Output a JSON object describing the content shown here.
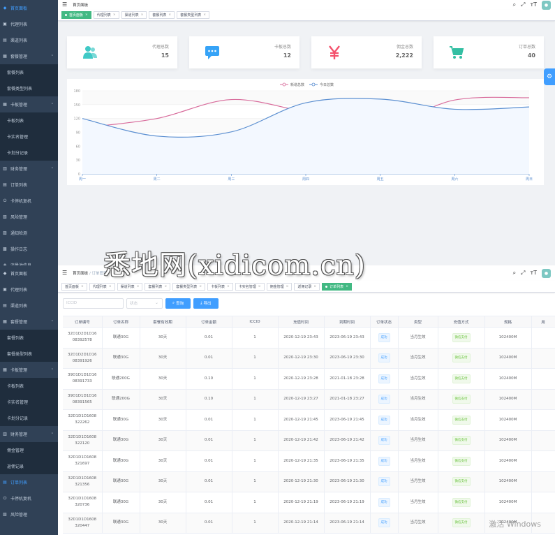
{
  "watermark": "悉地网(xidicom.cn)",
  "os_notice": "激活 Windows",
  "screen1": {
    "sidebar": [
      {
        "label": "首页面板",
        "icon": "dashboard-icon",
        "kind": "top",
        "active": true
      },
      {
        "label": "代理列表",
        "icon": "user-icon",
        "kind": "top"
      },
      {
        "label": "渠道列表",
        "icon": "list-icon",
        "kind": "top"
      },
      {
        "label": "套餐管理",
        "icon": "package-icon",
        "kind": "top",
        "expandable": true
      },
      {
        "label": "套餐列表",
        "kind": "sub"
      },
      {
        "label": "套餐类型列表",
        "kind": "sub"
      },
      {
        "label": "卡板管理",
        "icon": "grid-icon",
        "kind": "top",
        "expandable": true
      },
      {
        "label": "卡板列表",
        "kind": "sub"
      },
      {
        "label": "卡实名管理",
        "kind": "sub"
      },
      {
        "label": "卡划分记录",
        "kind": "sub"
      },
      {
        "label": "财务管理",
        "icon": "chart-icon",
        "kind": "top",
        "expandable": true
      },
      {
        "label": "订单列表",
        "icon": "order-icon",
        "kind": "top"
      },
      {
        "label": "卡停机复机",
        "icon": "power-icon",
        "kind": "top"
      },
      {
        "label": "风险管理",
        "icon": "shield-icon",
        "kind": "top"
      },
      {
        "label": "通知检测",
        "icon": "bell-icon",
        "kind": "top"
      },
      {
        "label": "操作日志",
        "icon": "log-icon",
        "kind": "top"
      },
      {
        "label": "流量池信息",
        "icon": "pool-icon",
        "kind": "top"
      }
    ],
    "breadcrumb": [
      "首页面板"
    ],
    "tags": [
      {
        "label": "首页面板",
        "active": true
      },
      {
        "label": "代理列表"
      },
      {
        "label": "渠道列表"
      },
      {
        "label": "套餐列表"
      },
      {
        "label": "套餐类型列表"
      }
    ],
    "cards": [
      {
        "label": "代理总数",
        "value": "15",
        "icon": "people-icon",
        "color": "#40c9c6"
      },
      {
        "label": "卡板总数",
        "value": "12",
        "icon": "message-icon",
        "color": "#36a3f7"
      },
      {
        "label": "佣金总数",
        "value": "2,222",
        "icon": "yen-icon",
        "color": "#f4516c"
      },
      {
        "label": "订单总数",
        "value": "40",
        "icon": "cart-icon",
        "color": "#34bfa3"
      }
    ]
  },
  "chart_data": {
    "type": "line",
    "categories": [
      "周一",
      "周二",
      "周三",
      "周四",
      "周五",
      "周六",
      "周日"
    ],
    "ylim": [
      0,
      180
    ],
    "yticks": [
      0,
      30,
      60,
      90,
      120,
      150,
      180
    ],
    "legend_position": "top-center",
    "grid": true,
    "series": [
      {
        "name": "新增总数",
        "color": "#d86b9b",
        "values": [
          100,
          120,
          161,
          134,
          105,
          160,
          165
        ]
      },
      {
        "name": "今日总数",
        "color": "#5b8fd1",
        "values": [
          120,
          82,
          91,
          154,
          162,
          140,
          145
        ]
      }
    ]
  },
  "screen2": {
    "sidebar": [
      {
        "label": "首页面板",
        "icon": "dashboard-icon",
        "kind": "top"
      },
      {
        "label": "代理列表",
        "icon": "user-icon",
        "kind": "top"
      },
      {
        "label": "渠道列表",
        "icon": "list-icon",
        "kind": "top"
      },
      {
        "label": "套餐管理",
        "icon": "package-icon",
        "kind": "top",
        "expandable": true
      },
      {
        "label": "套餐列表",
        "kind": "sub"
      },
      {
        "label": "套餐类型列表",
        "kind": "sub"
      },
      {
        "label": "卡板管理",
        "icon": "grid-icon",
        "kind": "top",
        "expandable": true
      },
      {
        "label": "卡板列表",
        "kind": "sub"
      },
      {
        "label": "卡实名管理",
        "kind": "sub"
      },
      {
        "label": "卡划分记录",
        "kind": "sub"
      },
      {
        "label": "财务管理",
        "icon": "chart-icon",
        "kind": "top",
        "expandable": true
      },
      {
        "label": "佣金管理",
        "kind": "sub"
      },
      {
        "label": "返佣记录",
        "kind": "sub"
      },
      {
        "label": "订单列表",
        "icon": "order-icon",
        "kind": "top",
        "active": true
      },
      {
        "label": "卡停机复机",
        "icon": "power-icon",
        "kind": "top"
      },
      {
        "label": "风险管理",
        "icon": "shield-icon",
        "kind": "top"
      }
    ],
    "breadcrumb": [
      "首页面板",
      "订单管理"
    ],
    "tags": [
      {
        "label": "首页面板"
      },
      {
        "label": "代理列表"
      },
      {
        "label": "渠道列表"
      },
      {
        "label": "套餐列表"
      },
      {
        "label": "套餐类型列表"
      },
      {
        "label": "卡板列表"
      },
      {
        "label": "卡实名管理"
      },
      {
        "label": "佣金管理"
      },
      {
        "label": "返佣记录"
      },
      {
        "label": "订单列表",
        "active": true
      }
    ],
    "search": {
      "iccid_placeholder": "ICCID",
      "status_placeholder": "状态",
      "query_label": "查询",
      "export_label": "导出"
    },
    "table": {
      "columns": [
        "订单编号",
        "订单名称",
        "套餐有效期",
        "订单金额",
        "ICCID",
        "充值时间",
        "到期时间",
        "订单状态",
        "类型",
        "充值方式",
        "规格",
        "用"
      ],
      "rows": [
        {
          "no": "32D1D2D1D16\n08392578",
          "name": "联通30G",
          "valid": "30天",
          "amount": "0.01",
          "iccid": "1",
          "pay": "2020-12-19 23:43",
          "expire": "2023-06-19 23:43",
          "status": "成功",
          "type": "当月生效",
          "method": "微信支付",
          "spec": "102400M"
        },
        {
          "no": "32D1D2D1D16\n08391926",
          "name": "联通30G",
          "valid": "30天",
          "amount": "0.01",
          "iccid": "1",
          "pay": "2020-12-19 23:30",
          "expire": "2023-06-19 23:30",
          "status": "成功",
          "type": "当月生效",
          "method": "微信支付",
          "spec": "102400M"
        },
        {
          "no": "39D1D1D1D16\n08391733",
          "name": "联通200G",
          "valid": "30天",
          "amount": "0.10",
          "iccid": "1",
          "pay": "2020-12-19 23:28",
          "expire": "2021-01-18 23:28",
          "status": "成功",
          "type": "当月生效",
          "method": "微信支付",
          "spec": "102400M"
        },
        {
          "no": "39D1D1D1D16\n08391565",
          "name": "联通200G",
          "valid": "30天",
          "amount": "0.10",
          "iccid": "1",
          "pay": "2020-12-19 23:27",
          "expire": "2021-01-18 23:27",
          "status": "成功",
          "type": "当月生效",
          "method": "微信支付",
          "spec": "102400M"
        },
        {
          "no": "32D1D1D1608\n322262",
          "name": "联通30G",
          "valid": "30天",
          "amount": "0.01",
          "iccid": "1",
          "pay": "2020-12-19 21:45",
          "expire": "2023-06-19 21:45",
          "status": "成功",
          "type": "当月生效",
          "method": "微信支付",
          "spec": "102400M"
        },
        {
          "no": "32D1D1D1608\n322120",
          "name": "联通30G",
          "valid": "30天",
          "amount": "0.01",
          "iccid": "1",
          "pay": "2020-12-19 21:42",
          "expire": "2023-06-19 21:42",
          "status": "成功",
          "type": "当月生效",
          "method": "微信支付",
          "spec": "102400M"
        },
        {
          "no": "32D1D1D1608\n321697",
          "name": "联通30G",
          "valid": "30天",
          "amount": "0.01",
          "iccid": "1",
          "pay": "2020-12-19 21:35",
          "expire": "2023-06-19 21:35",
          "status": "成功",
          "type": "当月生效",
          "method": "微信支付",
          "spec": "102400M"
        },
        {
          "no": "32D1D1D1608\n321356",
          "name": "联通30G",
          "valid": "30天",
          "amount": "0.01",
          "iccid": "1",
          "pay": "2020-12-19 21:30",
          "expire": "2023-06-19 21:30",
          "status": "成功",
          "type": "当月生效",
          "method": "微信支付",
          "spec": "102400M"
        },
        {
          "no": "32D1D1D1608\n320736",
          "name": "联通30G",
          "valid": "30天",
          "amount": "0.01",
          "iccid": "1",
          "pay": "2020-12-19 21:19",
          "expire": "2023-06-19 21:19",
          "status": "成功",
          "type": "当月生效",
          "method": "微信支付",
          "spec": "102400M"
        },
        {
          "no": "32D1D1D1608\n320447",
          "name": "联通30G",
          "valid": "30天",
          "amount": "0.01",
          "iccid": "1",
          "pay": "2020-12-19 21:14",
          "expire": "2023-06-19 21:14",
          "status": "成功",
          "type": "当月生效",
          "method": "微信支付",
          "spec": "102400M"
        }
      ]
    }
  }
}
